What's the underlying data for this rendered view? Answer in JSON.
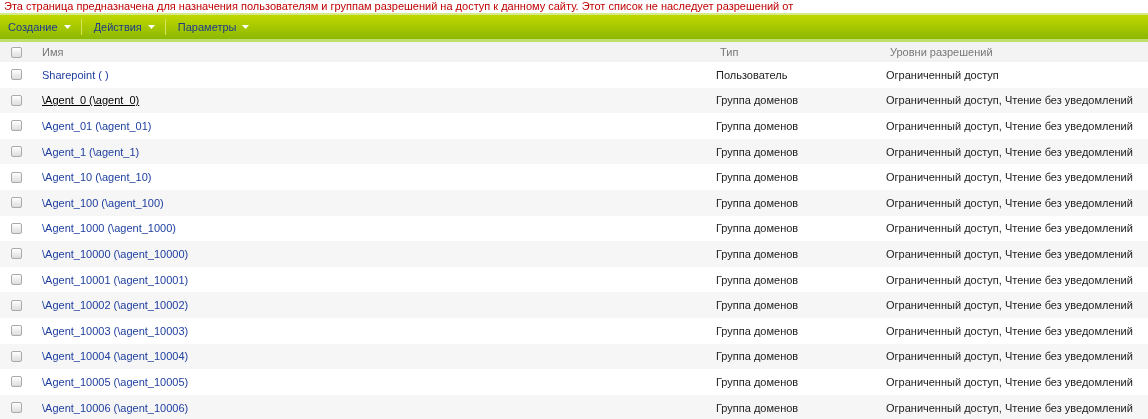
{
  "notice": "Эта страница предназначена для назначения пользователям и группам разрешений на доступ к данному сайту. Этот список не наследует разрешений от",
  "toolbar": [
    {
      "label": "Создание"
    },
    {
      "label": "Действия"
    },
    {
      "label": "Параметры"
    }
  ],
  "table": {
    "select_all_checked": false,
    "columns": [
      "Имя",
      "Тип",
      "Уровни разрешений"
    ],
    "rows": [
      {
        "name": "Sharepoint (  )",
        "type": "Пользователь",
        "levels": "Ограниченный доступ",
        "checked": false,
        "hovered": false
      },
      {
        "name": "\\Agent_0 (\\agent_0)",
        "type": "Группа доменов",
        "levels": "Ограниченный доступ, Чтение без уведомлений",
        "checked": false,
        "hovered": true
      },
      {
        "name": "\\Agent_01 (\\agent_01)",
        "type": "Группа доменов",
        "levels": "Ограниченный доступ, Чтение без уведомлений",
        "checked": false,
        "hovered": false
      },
      {
        "name": "\\Agent_1 (\\agent_1)",
        "type": "Группа доменов",
        "levels": "Ограниченный доступ, Чтение без уведомлений",
        "checked": false,
        "hovered": false
      },
      {
        "name": "\\Agent_10 (\\agent_10)",
        "type": "Группа доменов",
        "levels": "Ограниченный доступ, Чтение без уведомлений",
        "checked": false,
        "hovered": false
      },
      {
        "name": "\\Agent_100 (\\agent_100)",
        "type": "Группа доменов",
        "levels": "Ограниченный доступ, Чтение без уведомлений",
        "checked": false,
        "hovered": false
      },
      {
        "name": "\\Agent_1000 (\\agent_1000)",
        "type": "Группа доменов",
        "levels": "Ограниченный доступ, Чтение без уведомлений",
        "checked": false,
        "hovered": false
      },
      {
        "name": "\\Agent_10000 (\\agent_10000)",
        "type": "Группа доменов",
        "levels": "Ограниченный доступ, Чтение без уведомлений",
        "checked": false,
        "hovered": false
      },
      {
        "name": "\\Agent_10001 (\\agent_10001)",
        "type": "Группа доменов",
        "levels": "Ограниченный доступ, Чтение без уведомлений",
        "checked": false,
        "hovered": false
      },
      {
        "name": "\\Agent_10002 (\\agent_10002)",
        "type": "Группа доменов",
        "levels": "Ограниченный доступ, Чтение без уведомлений",
        "checked": false,
        "hovered": false
      },
      {
        "name": "\\Agent_10003 (\\agent_10003)",
        "type": "Группа доменов",
        "levels": "Ограниченный доступ, Чтение без уведомлений",
        "checked": false,
        "hovered": false
      },
      {
        "name": "\\Agent_10004 (\\agent_10004)",
        "type": "Группа доменов",
        "levels": "Ограниченный доступ, Чтение без уведомлений",
        "checked": false,
        "hovered": false
      },
      {
        "name": "\\Agent_10005 (\\agent_10005)",
        "type": "Группа доменов",
        "levels": "Ограниченный доступ, Чтение без уведомлений",
        "checked": false,
        "hovered": false
      },
      {
        "name": "\\Agent_10006 (\\agent_10006)",
        "type": "Группа доменов",
        "levels": "Ограниченный доступ, Чтение без уведомлений",
        "checked": false,
        "hovered": false
      }
    ]
  }
}
